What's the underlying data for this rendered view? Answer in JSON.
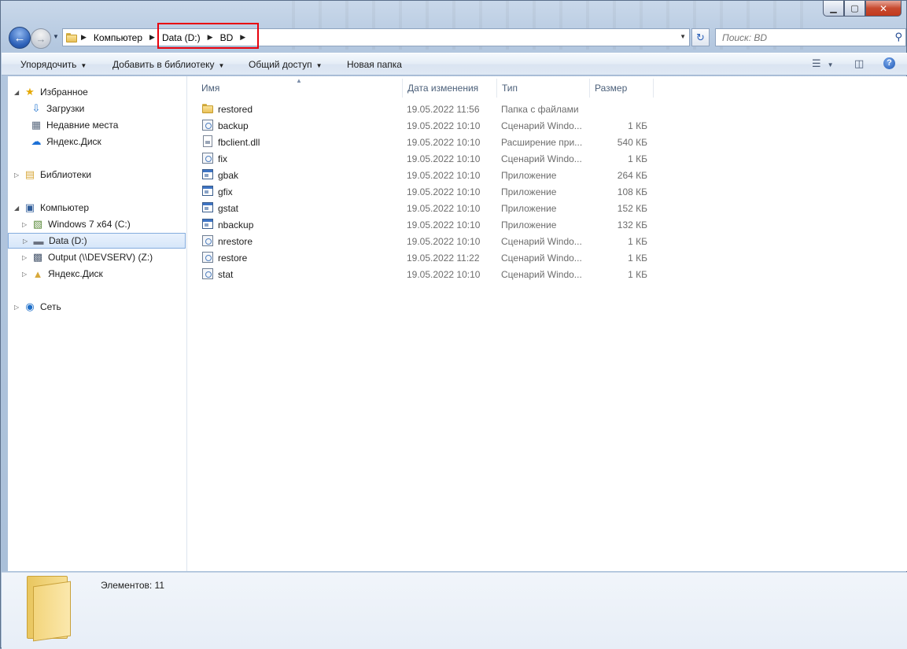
{
  "window": {
    "caption_buttons": {
      "minimize": "▁",
      "maximize": "▢",
      "close": "✕"
    }
  },
  "nav": {
    "breadcrumbs": [
      "Компьютер",
      "Data (D:)",
      "BD"
    ],
    "search_placeholder": "Поиск: BD"
  },
  "toolbar": {
    "organize": "Упорядочить",
    "add_to_library": "Добавить в библиотеку",
    "share": "Общий доступ",
    "new_folder": "Новая папка"
  },
  "sidebar": {
    "items": [
      {
        "label": "Избранное",
        "icon": "star-icon"
      },
      {
        "label": "Загрузки",
        "icon": "downloads-icon"
      },
      {
        "label": "Недавние места",
        "icon": "recent-places-icon"
      },
      {
        "label": "Яндекс.Диск",
        "icon": "yandex-disk-icon"
      },
      {
        "label": "Библиотеки",
        "icon": "libraries-icon"
      },
      {
        "label": "Компьютер",
        "icon": "computer-icon"
      },
      {
        "label": "Windows 7 x64 (C:)",
        "icon": "system-drive-icon"
      },
      {
        "label": "Data (D:)",
        "icon": "drive-icon",
        "selected": true
      },
      {
        "label": "Output (\\\\DEVSERV) (Z:)",
        "icon": "network-drive-icon"
      },
      {
        "label": "Яндекс.Диск",
        "icon": "yandex-disk-folder-icon"
      },
      {
        "label": "Сеть",
        "icon": "network-icon"
      }
    ]
  },
  "columns": {
    "name": "Имя",
    "date": "Дата изменения",
    "type": "Тип",
    "size": "Размер"
  },
  "files": [
    {
      "name": "restored",
      "date": "19.05.2022 11:56",
      "type": "Папка с файлами",
      "size": "",
      "icon": "folder-icon"
    },
    {
      "name": "backup",
      "date": "19.05.2022 10:10",
      "type": "Сценарий Windo...",
      "size": "1 КБ",
      "icon": "script-icon"
    },
    {
      "name": "fbclient.dll",
      "date": "19.05.2022 10:10",
      "type": "Расширение при...",
      "size": "540 КБ",
      "icon": "dll-icon"
    },
    {
      "name": "fix",
      "date": "19.05.2022 10:10",
      "type": "Сценарий Windo...",
      "size": "1 КБ",
      "icon": "script-icon"
    },
    {
      "name": "gbak",
      "date": "19.05.2022 10:10",
      "type": "Приложение",
      "size": "264 КБ",
      "icon": "app-icon"
    },
    {
      "name": "gfix",
      "date": "19.05.2022 10:10",
      "type": "Приложение",
      "size": "108 КБ",
      "icon": "app-icon"
    },
    {
      "name": "gstat",
      "date": "19.05.2022 10:10",
      "type": "Приложение",
      "size": "152 КБ",
      "icon": "app-icon"
    },
    {
      "name": "nbackup",
      "date": "19.05.2022 10:10",
      "type": "Приложение",
      "size": "132 КБ",
      "icon": "app-icon"
    },
    {
      "name": "nrestore",
      "date": "19.05.2022 10:10",
      "type": "Сценарий Windo...",
      "size": "1 КБ",
      "icon": "script-icon"
    },
    {
      "name": "restore",
      "date": "19.05.2022 11:22",
      "type": "Сценарий Windo...",
      "size": "1 КБ",
      "icon": "script-icon"
    },
    {
      "name": "stat",
      "date": "19.05.2022 10:10",
      "type": "Сценарий Windo...",
      "size": "1 КБ",
      "icon": "script-icon"
    }
  ],
  "status": {
    "items_count": "Элементов: 11"
  }
}
